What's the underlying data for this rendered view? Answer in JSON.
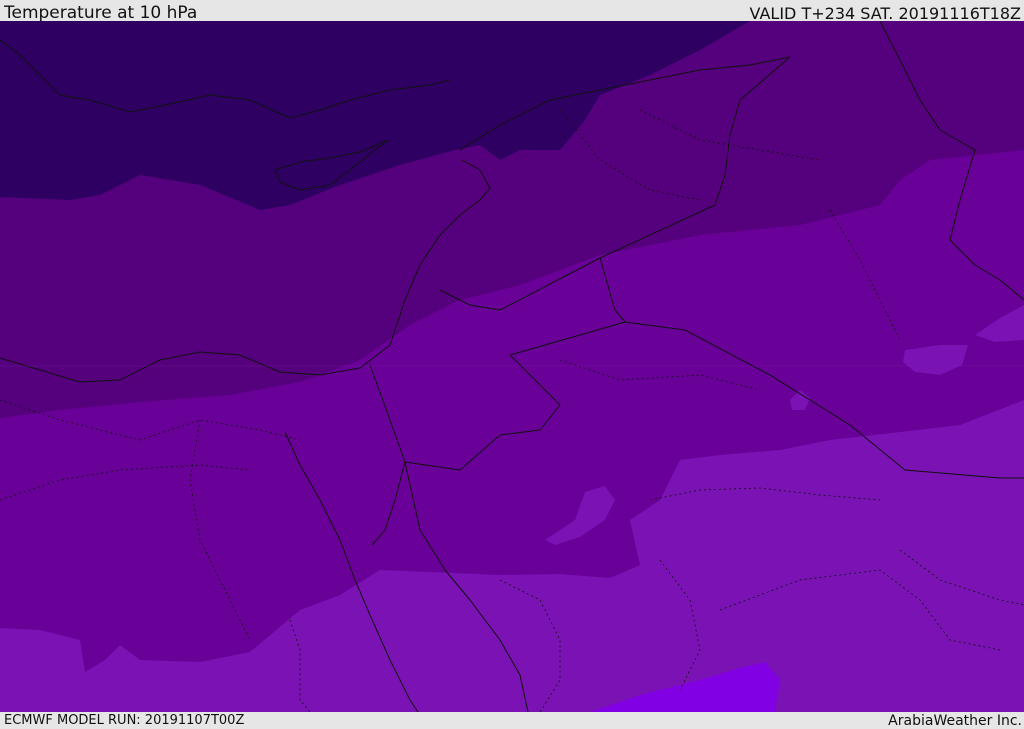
{
  "header": {
    "title": "Temperature at 10 hPa",
    "valid_time": "VALID T+234 SAT. 20191116T18Z"
  },
  "footer": {
    "model_run": "ECMWF MODEL RUN: 20191107T00Z",
    "credit": "ArabiaWeather Inc."
  },
  "map": {
    "colors": {
      "band_coldest": "#2e0062",
      "band_cold": "#55007c",
      "band_mid": "#690098",
      "band_warm": "#7a12b4",
      "band_warmest": "#8200e4",
      "border": "#111111"
    }
  }
}
